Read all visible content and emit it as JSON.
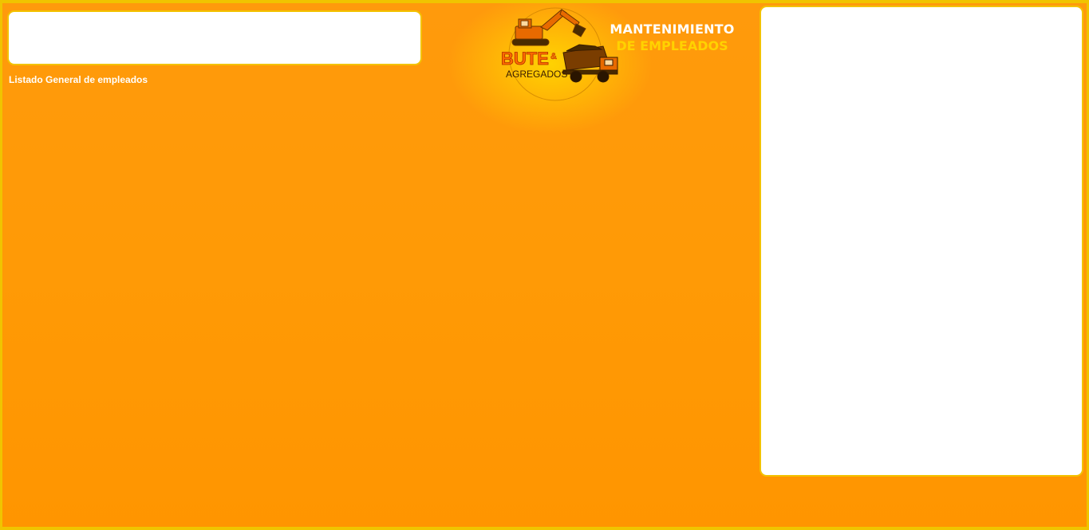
{
  "list": {
    "label": "Listado General de empleados"
  },
  "header": {
    "title_line1": "MANTENIMIENTO",
    "title_line2": "DE EMPLEADOS"
  },
  "logo": {
    "brand_main": "BUTE",
    "brand_amp": "&",
    "brand_sub": "AGREGADOS",
    "icons": [
      "excavator-icon",
      "dump-truck-icon"
    ]
  },
  "colors": {
    "background": "#ff9a06",
    "accent_yellow": "#ffd200",
    "border": "#f3c200",
    "panel": "#ffffff"
  }
}
